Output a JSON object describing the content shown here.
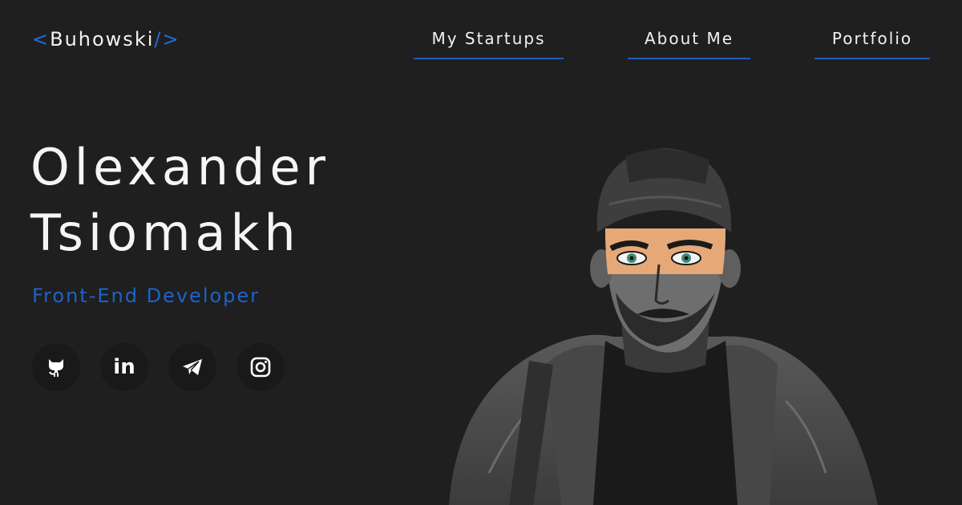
{
  "logo": {
    "open": "<",
    "name": "Buhowski",
    "close": "/>"
  },
  "nav": [
    {
      "label": "My Startups"
    },
    {
      "label": "About Me"
    },
    {
      "label": "Portfolio"
    }
  ],
  "hero": {
    "first_name": "Olexander",
    "last_name": "Tsiomakh",
    "role": "Front-End Developer"
  },
  "socials": [
    {
      "icon": "github-icon"
    },
    {
      "icon": "linkedin-icon",
      "text": "in"
    },
    {
      "icon": "telegram-icon"
    },
    {
      "icon": "instagram-icon"
    }
  ],
  "colors": {
    "background": "#1f1f1f",
    "accent": "#1f6fd6",
    "text": "#f2f2f2",
    "social_bg": "#191919",
    "eye_highlight": "#e7a878"
  }
}
